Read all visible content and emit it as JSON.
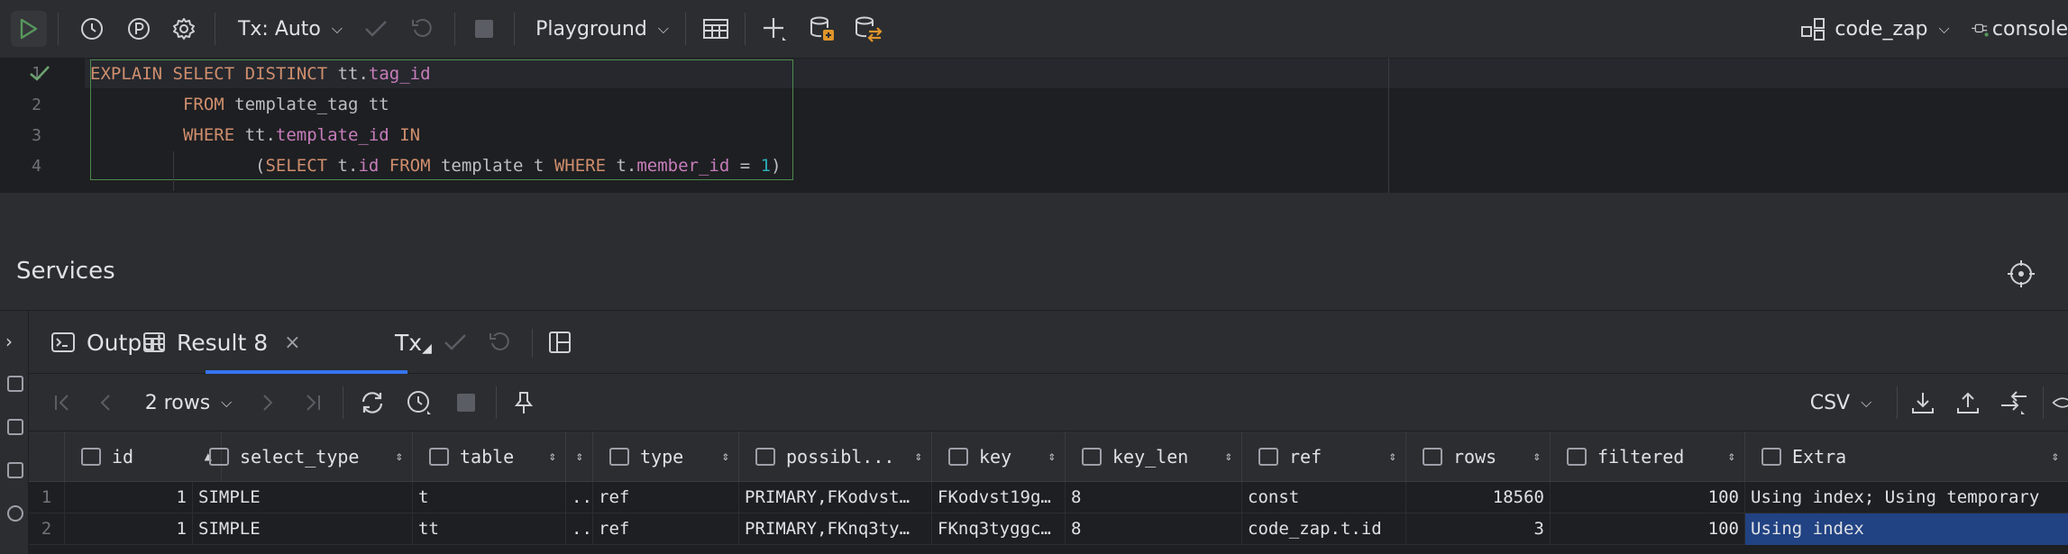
{
  "toolbar": {
    "tx_label": "Tx: Auto",
    "session_label": "Playground",
    "datasource_label": "code_zap",
    "console_label": "console"
  },
  "editor": {
    "lines": [
      {
        "n": "1",
        "parts": [
          [
            "kw",
            "EXPLAIN"
          ],
          [
            "t",
            " "
          ],
          [
            "kw",
            "SELECT"
          ],
          [
            "t",
            " "
          ],
          [
            "kw",
            "DISTINCT"
          ],
          [
            "t",
            " tt."
          ],
          [
            "fld",
            "tag_id"
          ]
        ]
      },
      {
        "n": "2",
        "parts": [
          [
            "t",
            "         "
          ],
          [
            "kw",
            "FROM"
          ],
          [
            "t",
            " template_tag tt"
          ]
        ]
      },
      {
        "n": "3",
        "parts": [
          [
            "t",
            "         "
          ],
          [
            "kw",
            "WHERE"
          ],
          [
            "t",
            " tt."
          ],
          [
            "fld",
            "template_id"
          ],
          [
            "t",
            " "
          ],
          [
            "kw",
            "IN"
          ]
        ]
      },
      {
        "n": "4",
        "parts": [
          [
            "t",
            "                ("
          ],
          [
            "kw",
            "SELECT"
          ],
          [
            "t",
            " t."
          ],
          [
            "fld",
            "id"
          ],
          [
            "t",
            " "
          ],
          [
            "kw",
            "FROM"
          ],
          [
            "t",
            " template t "
          ],
          [
            "kw",
            "WHERE"
          ],
          [
            "t",
            " t."
          ],
          [
            "fld",
            "member_id"
          ],
          [
            "t",
            " = "
          ],
          [
            "num",
            "1"
          ],
          [
            "t",
            ")"
          ]
        ]
      }
    ]
  },
  "services": {
    "title": "Services"
  },
  "tabs": {
    "output": "Output",
    "result": "Result 8",
    "tx": "Tx"
  },
  "result_toolbar": {
    "rows_label": "2 rows",
    "export_format": "CSV"
  },
  "grid": {
    "columns": [
      "id",
      "select_type",
      "table",
      "",
      "type",
      "possibl...",
      "key",
      "key_len",
      "ref",
      "rows",
      "filtered",
      "Extra"
    ],
    "rows": [
      {
        "num": "1",
        "id": "1",
        "select_type": "SIMPLE",
        "table": "t",
        "part": "...",
        "type": "ref",
        "possible_keys": "PRIMARY,FKodvst…",
        "key": "FKodvst19g…",
        "key_len": "8",
        "ref": "const",
        "rows": "18560",
        "filtered": "100",
        "extra": "Using index; Using temporary"
      },
      {
        "num": "2",
        "id": "1",
        "select_type": "SIMPLE",
        "table": "tt",
        "part": "...",
        "type": "ref",
        "possible_keys": "PRIMARY,FKnq3ty…",
        "key": "FKnq3tyggc…",
        "key_len": "8",
        "ref": "code_zap.t.id",
        "rows": "3",
        "filtered": "100",
        "extra": "Using index"
      }
    ]
  },
  "colors": {
    "accent": "#3574f0",
    "run_green": "#57965c",
    "keyword": "#cf8e6d",
    "field": "#c77dbb",
    "number": "#2aacb8",
    "selection": "#214283"
  }
}
